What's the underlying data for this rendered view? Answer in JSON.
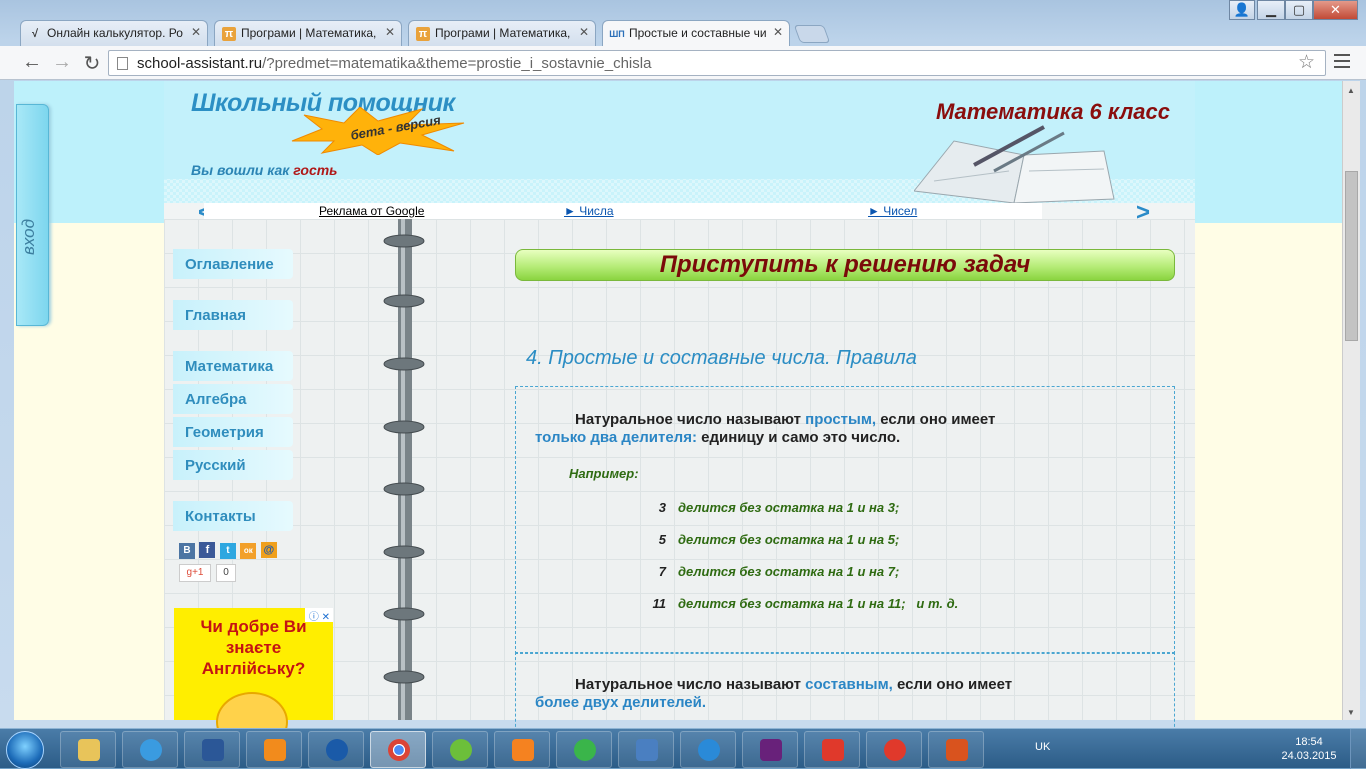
{
  "browser": {
    "tabs": [
      {
        "label": "Онлайн калькулятор. Ро",
        "icon": "√"
      },
      {
        "label": "Програми | Математика,",
        "icon": "π"
      },
      {
        "label": "Програми | Математика,",
        "icon": "π"
      },
      {
        "label": "Простые и составные чи",
        "icon": "ШП"
      }
    ],
    "url_host": "school-assistant.ru",
    "url_path": "/?predmet=matematika&theme=prostie_i_sostavnie_chisla"
  },
  "login_tab": "вход",
  "header": {
    "site_title": "Школьный помощник",
    "beta": "бета - версия",
    "logged_prefix": "Вы вошли как",
    "logged_user": "гость",
    "subject": "Математика 6 класс"
  },
  "adbar": {
    "label": "Реклама от Google",
    "link1": "► Числа",
    "link2": "► Чисел"
  },
  "sidebar": {
    "items": [
      "Оглавление",
      "Главная",
      "Математика",
      "Алгебра",
      "Геометрия",
      "Русский",
      "Контакты"
    ],
    "social": [
      "В",
      "f",
      "t",
      "ок",
      "@"
    ],
    "gplus": "g+1",
    "gplus_count": "0"
  },
  "ad": {
    "text": "Чи добре Ви знаєте Англійську?"
  },
  "main": {
    "start_button": "Приступить к решению задач",
    "heading": "4. Простые и составные числа. Правила",
    "rule1_a": "Натуральное число называют ",
    "rule1_b": "простым,",
    "rule1_c": " если оно имеет",
    "rule1_d": "только два делителя:",
    "rule1_e": " единицу и само это число.",
    "example_label": "Например:",
    "examples": [
      {
        "n": "3",
        "text": "делится без остатка на 1 и на 3;",
        "tail": ""
      },
      {
        "n": "5",
        "text": "делится без остатка на 1 и на 5;",
        "tail": ""
      },
      {
        "n": "7",
        "text": "делится без остатка на 1 и на 7;",
        "tail": ""
      },
      {
        "n": "11",
        "text": "делится без остатка на 1 и на 11;",
        "tail": "и т. д."
      }
    ],
    "rule2_a": "Натуральное число называют ",
    "rule2_b": "составным,",
    "rule2_c": " если оно имеет",
    "rule2_d": "более двух делителей."
  },
  "taskbar": {
    "lang": "UK",
    "time": "18:54",
    "date": "24.03.2015"
  }
}
